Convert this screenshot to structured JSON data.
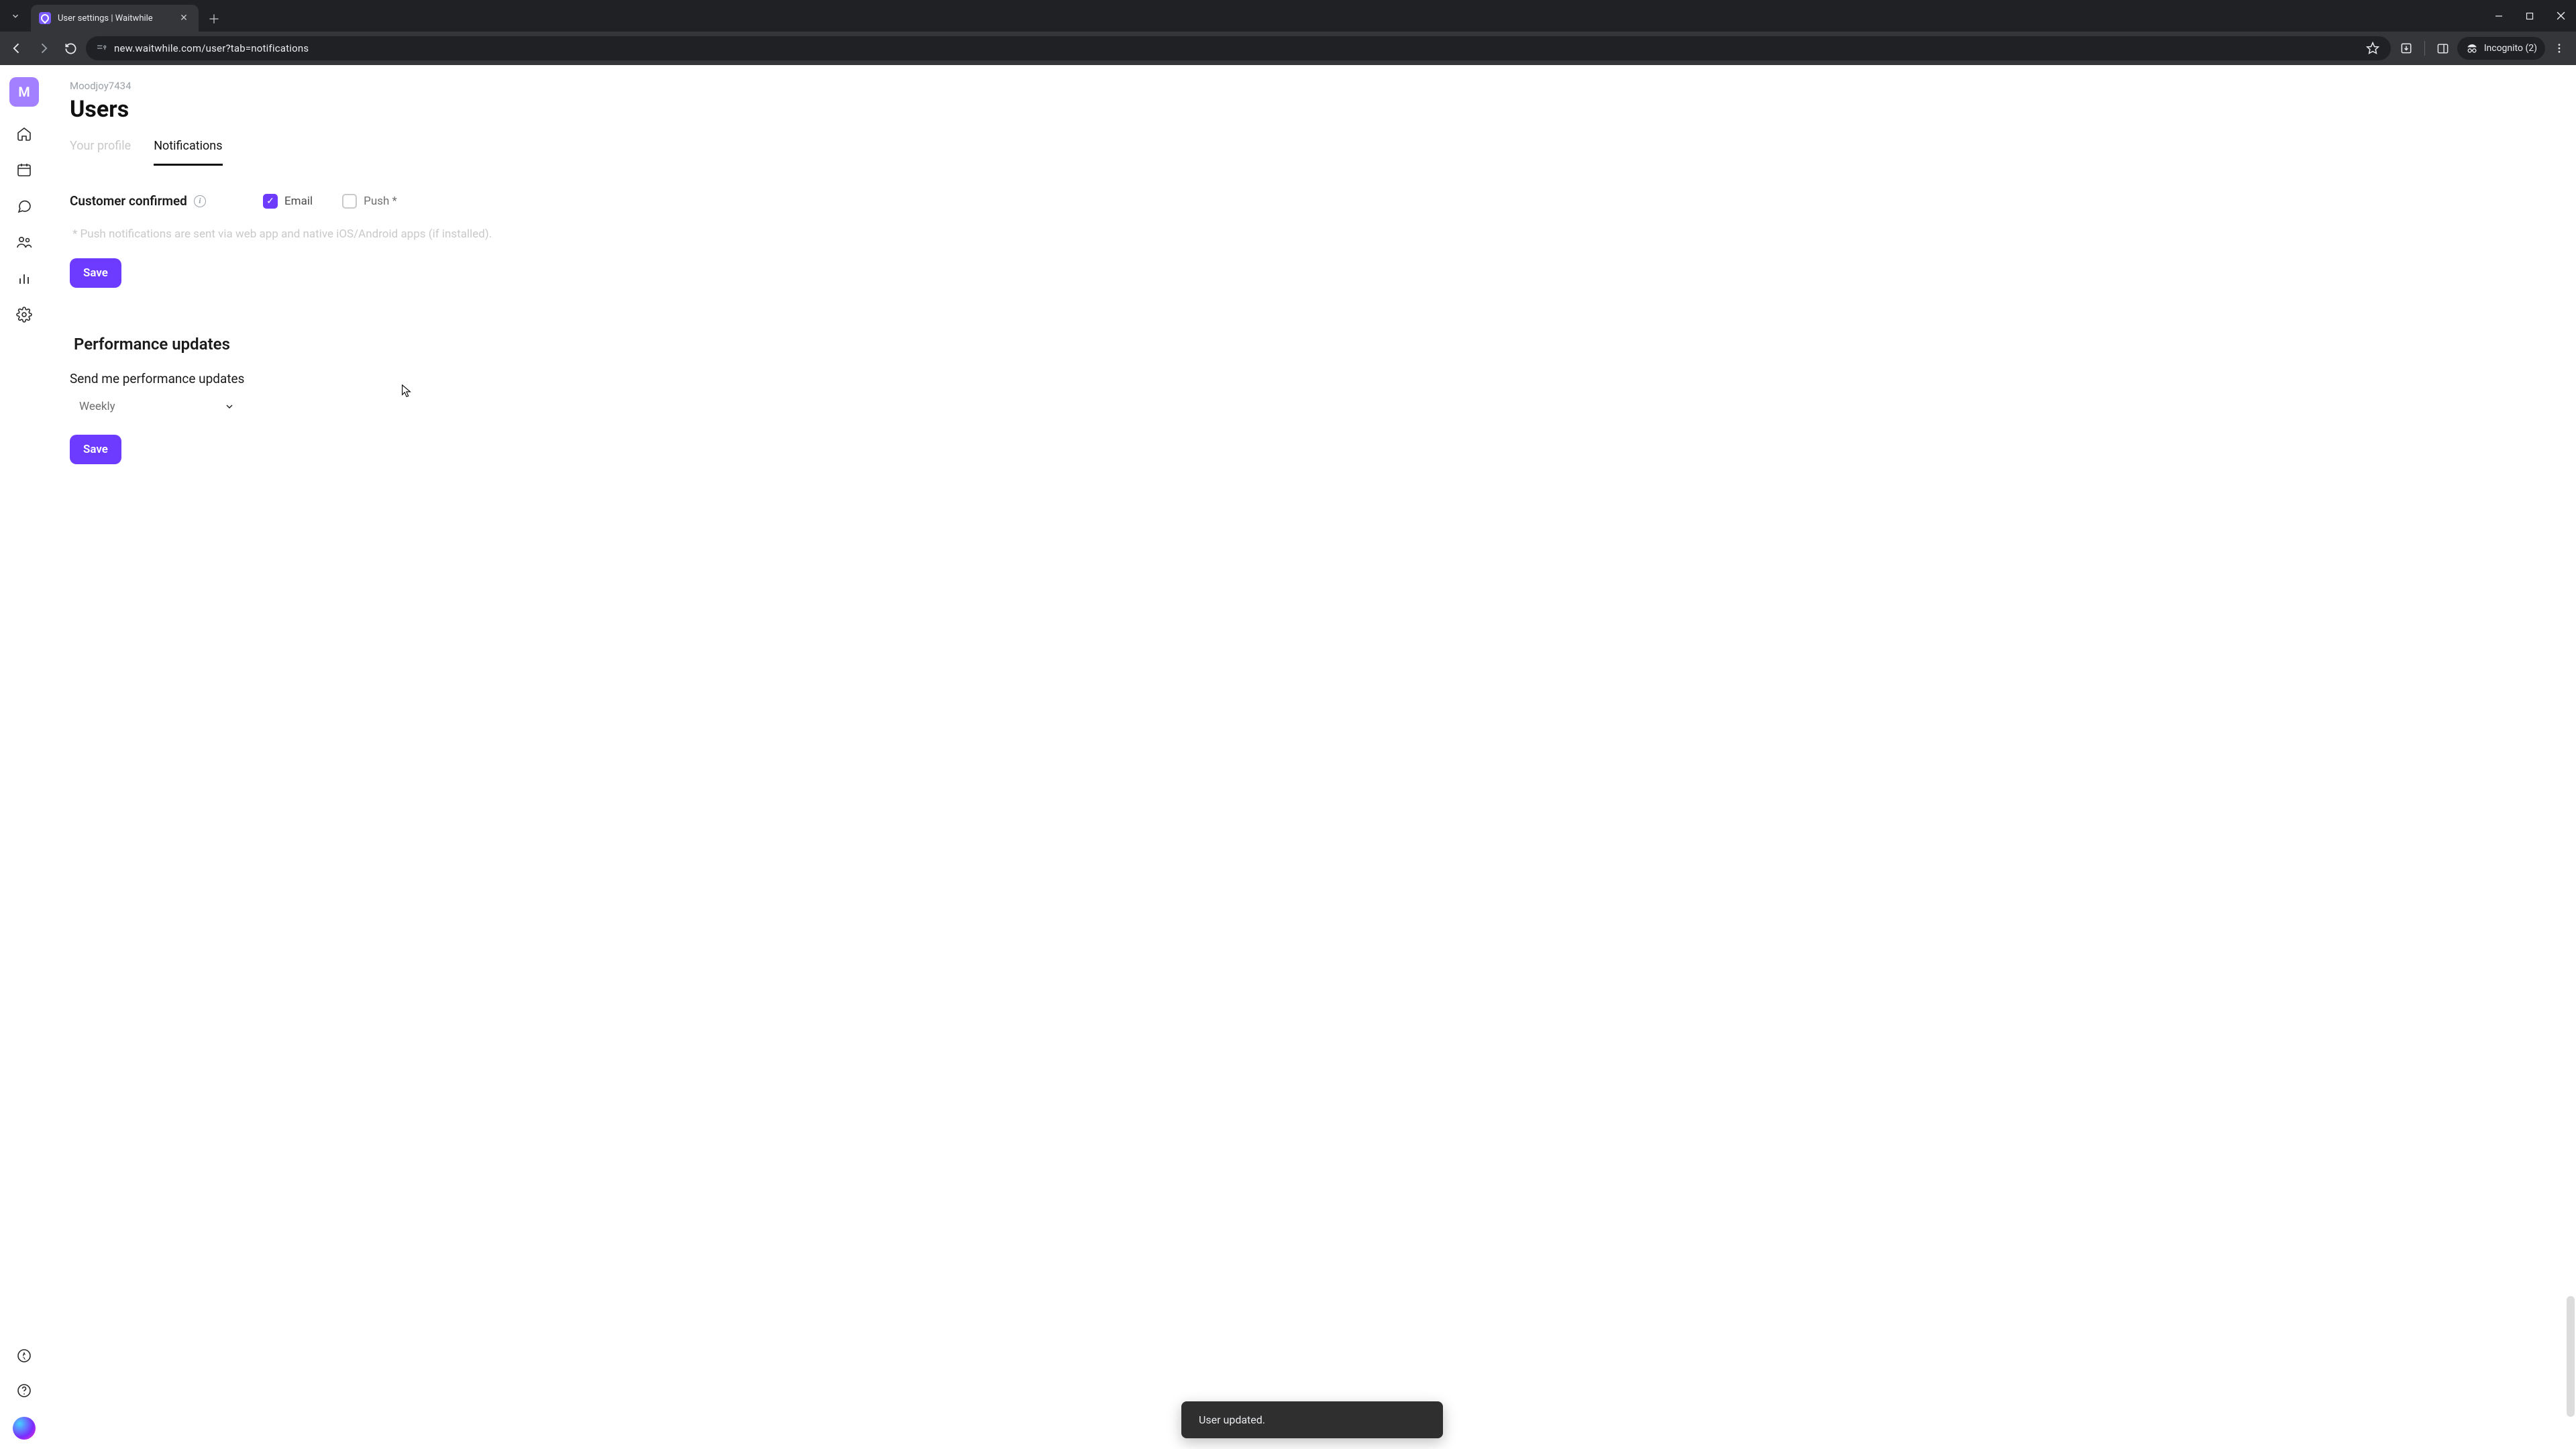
{
  "browser": {
    "tab_title": "User settings | Waitwhile",
    "url": "new.waitwhile.com/user?tab=notifications",
    "incognito_label": "Incognito (2)"
  },
  "sidebar": {
    "avatar_letter": "M"
  },
  "header": {
    "breadcrumb": "Moodjoy7434",
    "title": "Users",
    "tabs": {
      "profile": "Your profile",
      "notifications": "Notifications"
    }
  },
  "notifications_section": {
    "row_label": "Customer confirmed",
    "email_label": "Email",
    "email_checked": true,
    "push_label": "Push",
    "push_checked": false,
    "footnote": "* Push notifications are sent via web app and native iOS/Android apps (if installed).",
    "save_label": "Save"
  },
  "performance_section": {
    "heading": "Performance updates",
    "field_label": "Send me performance updates",
    "select_value": "Weekly",
    "save_label": "Save"
  },
  "toast": {
    "message": "User updated."
  }
}
